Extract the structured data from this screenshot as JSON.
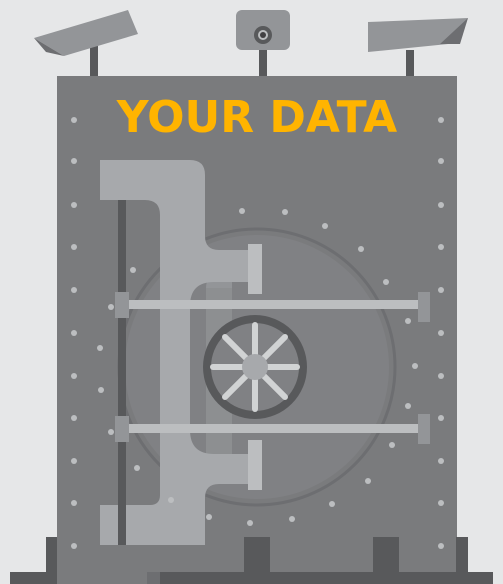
{
  "title": "YOUR DATA",
  "colors": {
    "background": "#e6e7e8",
    "vault_body": "#7a7b7d",
    "vault_frame": "#58595b",
    "hinge": "#a7a9ac",
    "bolts": "#bcbec0",
    "wheel_ring": "#58595b",
    "wheel_spokes": "#d1d3d4",
    "camera": "#939598",
    "title": "#ffb400"
  },
  "icons": [
    "security-camera-icon",
    "security-camera-icon",
    "security-camera-icon",
    "vault-wheel-icon"
  ]
}
